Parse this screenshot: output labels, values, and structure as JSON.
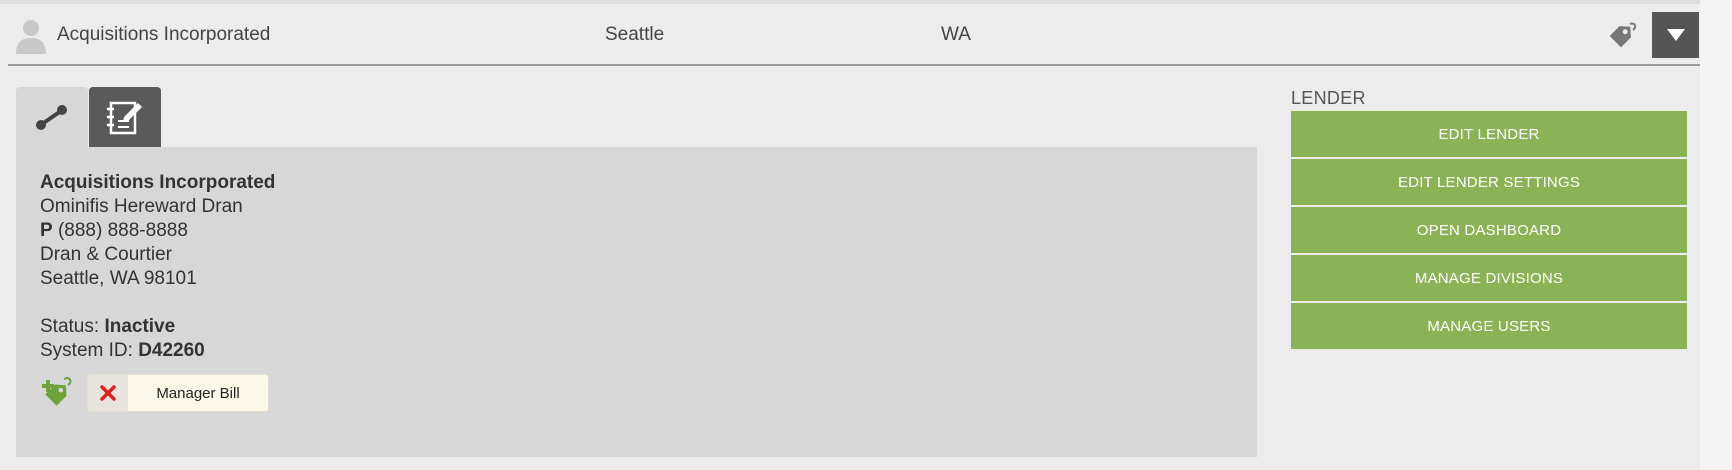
{
  "header": {
    "name": "Acquisitions Incorporated",
    "city": "Seattle",
    "state": "WA"
  },
  "tabs": [
    {
      "icon": "connections-icon",
      "active": true
    },
    {
      "icon": "notes-icon",
      "active": false
    }
  ],
  "details": {
    "company": "Acquisitions Incorporated",
    "contact": "Ominifis Hereward Dran",
    "phone_label": "P",
    "phone": "(888) 888-8888",
    "address_line": "Dran & Courtier",
    "city_state_zip": "Seattle, WA 98101",
    "status_label": "Status:",
    "status": "Inactive",
    "system_id_label": "System ID:",
    "system_id": "D42260",
    "tag_chip": "Manager Bill"
  },
  "lender": {
    "title": "LENDER",
    "buttons": [
      "EDIT LENDER",
      "EDIT LENDER SETTINGS",
      "OPEN DASHBOARD",
      "MANAGE DIVISIONS",
      "MANAGE USERS"
    ]
  },
  "colors": {
    "accent_green": "#8ab355",
    "dark_button": "#555555",
    "panel": "#d7d7d7",
    "remove_red": "#e0201b"
  }
}
